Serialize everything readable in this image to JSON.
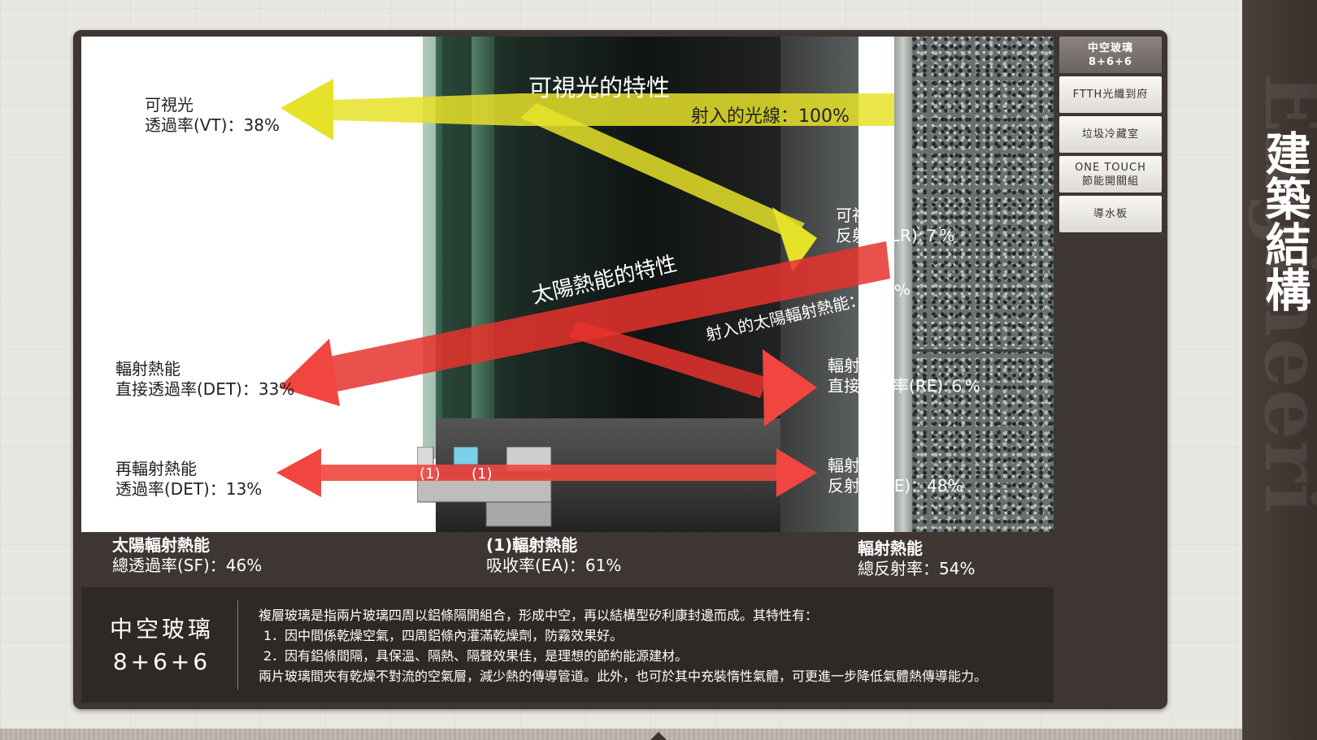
{
  "side_title": "建築結構",
  "side_watermark": "Engineeri",
  "menu": {
    "items": [
      {
        "label_line1": "中空玻璃",
        "label_line2": "8+6+6",
        "active": true
      },
      {
        "label_line1": "FTTH光纖到府",
        "label_line2": "",
        "active": false
      },
      {
        "label_line1": "垃圾冷藏室",
        "label_line2": "",
        "active": false
      },
      {
        "label_line1": "ONE TOUCH",
        "label_line2": "節能開關組",
        "active": false
      },
      {
        "label_line1": "導水板",
        "label_line2": "",
        "active": false
      }
    ]
  },
  "diagram": {
    "visible_light_title": "可視光的特性",
    "incident_light": "射入的光線：100%",
    "vt_line1": "可視光",
    "vt_line2": "透過率(VT)：38%",
    "lr_line1": "可視光",
    "lr_line2": "反射率(LR):７%",
    "solar_title": "太陽熱能的特性",
    "incident_solar": "射入的太陽輻射熱能：100%",
    "det_line1": "輻射熱能",
    "det_line2": "直接透過率(DET)：33%",
    "re_direct_line1": "輻射熱能",
    "re_direct_line2": "直接反射率(RE):６%",
    "reradiate_line1": "再輻射熱能",
    "reradiate_line2": "透過率(DET)：13%",
    "re_line1": "輻射熱能",
    "re_line2": "反射率(RE)：48%",
    "mark1": "(1)",
    "mark2": "(1)"
  },
  "summary": {
    "sf_line1": "太陽輻射熱能",
    "sf_line2": "總透過率(SF)：46%",
    "ea_line1": "(1)輻射熱能",
    "ea_line2": "吸收率(EA)：61%",
    "tr_line1": "輻射熱能",
    "tr_line2": "總反射率：54%"
  },
  "description": {
    "title_line1": "中空玻璃",
    "title_line2": "8+6+6",
    "intro": "複層玻璃是指兩片玻璃四周以鋁條隔開組合，形成中空，再以結構型矽利康封邊而成。其特性有：",
    "point1": "1．因中間係乾燥空氣，四周鋁條內灌滿乾燥劑，防霧效果好。",
    "point2": "2．因有鋁條間隔，具保溫、隔熱、隔聲效果佳，是理想的節約能源建材。",
    "closing": "兩片玻璃間夾有乾燥不對流的空氣層，減少熱的傳導管道。此外，也可於其中充裝惰性氣體，可更進一步降低氣體熱傳導能力。"
  },
  "colors": {
    "yellow_arrow": "#e6e22a",
    "red_arrow": "#f0463f",
    "panel_brown": "#3d3633"
  }
}
